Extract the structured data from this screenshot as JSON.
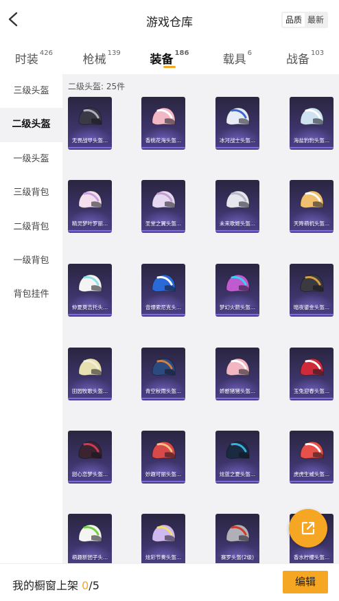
{
  "header": {
    "title": "游戏仓库",
    "sort_options": [
      "品质",
      "最新"
    ],
    "sort_active": 0
  },
  "tabs": [
    {
      "label": "时装",
      "count": "426"
    },
    {
      "label": "枪械",
      "count": "139"
    },
    {
      "label": "装备",
      "count": "186",
      "active": true
    },
    {
      "label": "载具",
      "count": "6"
    },
    {
      "label": "战备",
      "count": "103"
    }
  ],
  "sidebar": {
    "items": [
      "三级头盔",
      "二级头盔",
      "一级头盔",
      "三级背包",
      "二级背包",
      "一级背包",
      "背包挂件"
    ],
    "active": 1
  },
  "section": {
    "title": "二级头盔: 25件"
  },
  "items": [
    {
      "label": "无畏战甲头盔...",
      "color": "#3a3a46",
      "accent": "#b0b0c0"
    },
    {
      "label": "香桃花海头盔...",
      "color": "#f2b8c6",
      "accent": "#ffffff"
    },
    {
      "label": "冰河战士头盔...",
      "color": "#e8ecf6",
      "accent": "#3a6ad0"
    },
    {
      "label": "海盐豹豹头盔...",
      "color": "#cfe2f0",
      "accent": "#ffffff"
    },
    {
      "label": "精灵梦叶罗丽...",
      "color": "#f4e0ec",
      "accent": "#c8a0e0"
    },
    {
      "label": "圣堂之翼头盔...",
      "color": "#e6d8f0",
      "accent": "#c0a0d0"
    },
    {
      "label": "未来歌姬头盔...",
      "color": "#e6e6ee",
      "accent": "#b8b8c8"
    },
    {
      "label": "天降萌机头盔...",
      "color": "#f0c070",
      "accent": "#ffffff"
    },
    {
      "label": "仲夏莫吉托头...",
      "color": "#f4f4f4",
      "accent": "#8ee0e0"
    },
    {
      "label": "音爆索尼克头...",
      "color": "#2a6ad8",
      "accent": "#ffffff"
    },
    {
      "label": "梦幻火箭头盔...",
      "color": "#c05ad0",
      "accent": "#3ad0f0"
    },
    {
      "label": "暗夜鎏金头盔...",
      "color": "#3a3a40",
      "accent": "#d4a040"
    },
    {
      "label": "田园牧歌头盔...",
      "color": "#e8e0b0",
      "accent": "#f4f0d8"
    },
    {
      "label": "青空秋雨头盔...",
      "color": "#2a4a80",
      "accent": "#d08040"
    },
    {
      "label": "娇憨猪猪头盔...",
      "color": "#f2b6c2",
      "accent": "#ffffff"
    },
    {
      "label": "玉兔迎春头盔...",
      "color": "#d02a3a",
      "accent": "#ffffff"
    },
    {
      "label": "甜心恋梦头盔...",
      "color": "#3a2430",
      "accent": "#d03a5a"
    },
    {
      "label": "妙趣可丽头盔...",
      "color": "#d84a4a",
      "accent": "#f0c080"
    },
    {
      "label": "炫蓝之夏头盔...",
      "color": "#1a2a40",
      "accent": "#3ab0e0"
    },
    {
      "label": "虎虎生威头盔...",
      "color": "#e8504a",
      "accent": "#ffffff"
    },
    {
      "label": "萌趣新团子头...",
      "color": "#f4f4f0",
      "accent": "#70d040"
    },
    {
      "label": "炫彩节奏头盔...",
      "color": "#d0b8f0",
      "accent": "#f0e070"
    },
    {
      "label": "赛罗头盔(2级)",
      "color": "#b0b0b8",
      "accent": "#d03a2a"
    },
    {
      "label": "香水柠檬头盔...",
      "color": "#f0d040",
      "accent": "#80c040"
    }
  ],
  "bottom": {
    "shelf_label": "我的橱窗上架",
    "shelf_current": "0",
    "shelf_total": "/5",
    "edit_label": "编辑"
  },
  "icons": {
    "back": "chevron-left-icon",
    "share": "external-link-icon"
  },
  "colors": {
    "accent": "#f5a623",
    "card_bg": "#3b3366"
  }
}
